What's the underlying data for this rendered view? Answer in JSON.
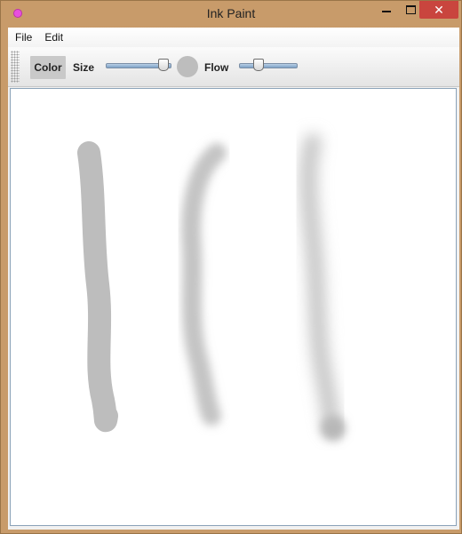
{
  "window": {
    "title": "Ink Paint",
    "controls": {
      "minimize": "—",
      "maximize": "□",
      "close": "✕"
    }
  },
  "menu": {
    "items": [
      "File",
      "Edit"
    ]
  },
  "toolbar": {
    "color_label": "Color",
    "size_label": "Size",
    "flow_label": "Flow",
    "size_value": 0.95,
    "flow_value": 0.3,
    "brush_color": "#bdbdbd"
  },
  "icons": {
    "app": "paint-app-icon",
    "grip": "toolbar-grip-icon"
  }
}
